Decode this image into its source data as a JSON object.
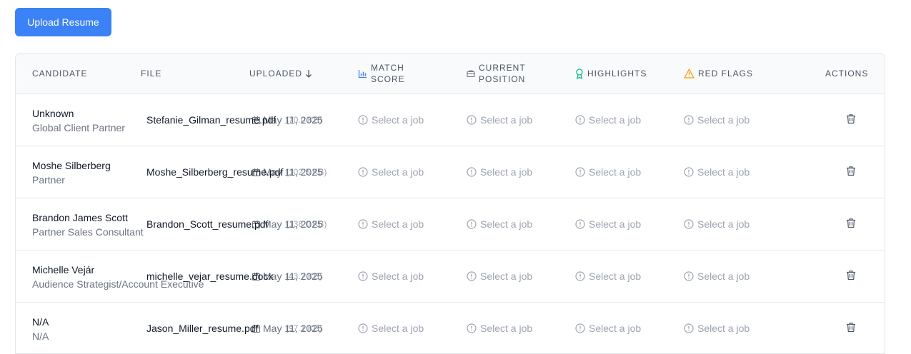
{
  "toolbar": {
    "upload_label": "Upload Resume"
  },
  "table": {
    "columns": {
      "candidate": "CANDIDATE",
      "file": "FILE",
      "uploaded": "UPLOADED",
      "match_score_1": "MATCH",
      "match_score_2": "SCORE",
      "current_position_1": "CURRENT",
      "current_position_2": "POSITION",
      "highlights": "HIGHLIGHTS",
      "red_flags": "RED FLAGS",
      "actions": "ACTIONS"
    },
    "rows": [
      {
        "name": "Unknown",
        "title": "Global Client Partner",
        "file": "Stefanie_Gilman_resume.pdf",
        "size": "(70.0 KB)",
        "date": "May 11, 2025",
        "match": "Select a job",
        "position": "Select a job",
        "highlights": "Select a job",
        "red_flags": "Select a job"
      },
      {
        "name": "Moshe Silberberg",
        "title": "Partner",
        "file": "Moshe_Silberberg_resume.pdf",
        "size": "(102.5 KB)",
        "date": "May 11, 2025",
        "match": "Select a job",
        "position": "Select a job",
        "highlights": "Select a job",
        "red_flags": "Select a job"
      },
      {
        "name": "Brandon James Scott",
        "title": "Partner Sales Consultant",
        "file": "Brandon_Scott_resume.pdf",
        "size": "(138.0 KB)",
        "date": "May 11, 2025",
        "match": "Select a job",
        "position": "Select a job",
        "highlights": "Select a job",
        "red_flags": "Select a job"
      },
      {
        "name": "Michelle Vejár",
        "title": "Audience Strategist/Account Executive",
        "file": "michelle_vejar_resume.docx",
        "size": "(43.7 KB)",
        "date": "May 11, 2025",
        "match": "Select a job",
        "position": "Select a job",
        "highlights": "Select a job",
        "red_flags": "Select a job"
      },
      {
        "name": "N/A",
        "title": "N/A",
        "file": "Jason_Miller_resume.pdf",
        "size": "(97.1 KB)",
        "date": "May 11, 2025",
        "match": "Select a job",
        "position": "Select a job",
        "highlights": "Select a job",
        "red_flags": "Select a job"
      }
    ]
  },
  "icons": {
    "match_score": "bar-chart-icon",
    "current_position": "briefcase-icon",
    "highlights": "award-icon",
    "red_flags": "alert-triangle-icon",
    "sort": "arrow-down-icon",
    "info": "info-circle-icon",
    "calendar": "calendar-icon",
    "delete": "trash-icon"
  },
  "colors": {
    "primary": "#3b82f6",
    "highlight_icon": "#10b981",
    "warning_icon": "#f59e0b",
    "muted_text": "#9ca3af"
  }
}
